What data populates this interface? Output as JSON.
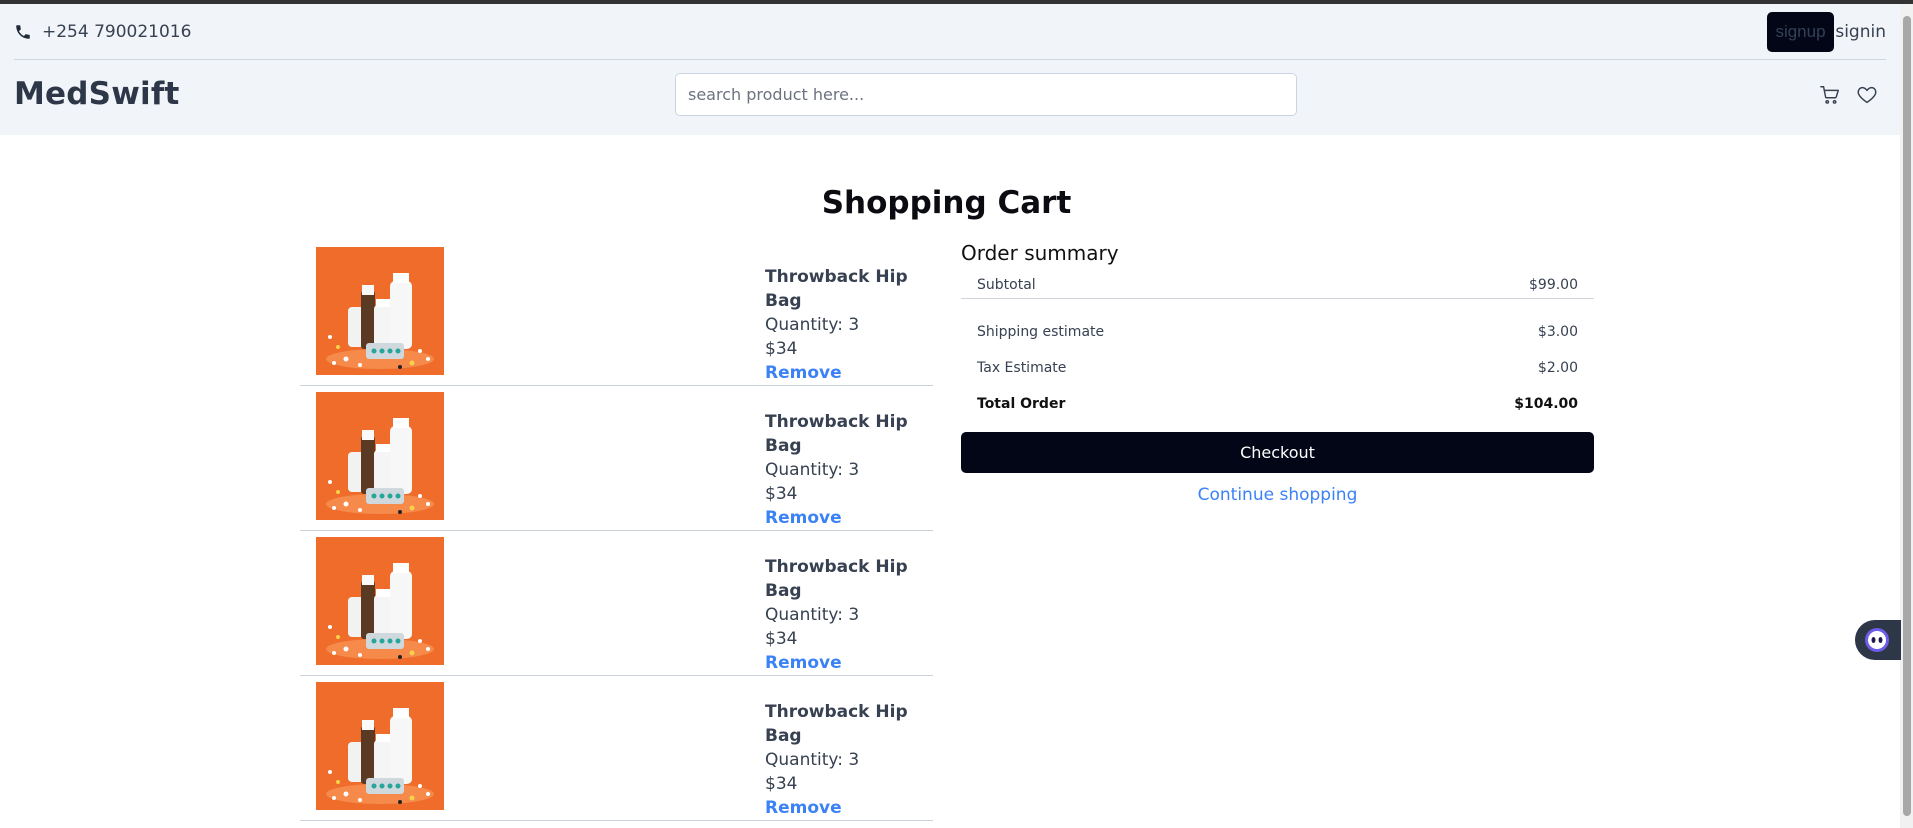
{
  "header": {
    "phone": "+254 790021016",
    "signup_label": "signup",
    "signin_label": "signin",
    "logo": "MedSwift",
    "search_placeholder": "search product here..."
  },
  "cart": {
    "title": "Shopping Cart",
    "items": [
      {
        "name": "Throwback Hip Bag",
        "quantity": "Quantity: 3",
        "price": "$34",
        "remove": "Remove"
      },
      {
        "name": "Throwback Hip Bag",
        "quantity": "Quantity: 3",
        "price": "$34",
        "remove": "Remove"
      },
      {
        "name": "Throwback Hip Bag",
        "quantity": "Quantity: 3",
        "price": "$34",
        "remove": "Remove"
      },
      {
        "name": "Throwback Hip Bag",
        "quantity": "Quantity: 3",
        "price": "$34",
        "remove": "Remove"
      }
    ]
  },
  "summary": {
    "title": "Order summary",
    "subtotal_label": "Subtotal",
    "subtotal_value": "$99.00",
    "shipping_label": "Shipping estimate",
    "shipping_value": "$3.00",
    "tax_label": "Tax Estimate",
    "tax_value": "$2.00",
    "total_label": "Total Order",
    "total_value": "$104.00",
    "checkout_label": "Checkout",
    "continue_label": "Continue shopping"
  },
  "icons": {
    "phone": "phone-icon",
    "cart": "cart-icon",
    "wishlist": "heart-icon",
    "chat": "chatbot-icon"
  },
  "colors": {
    "accent": "#3b82f6",
    "primary_button": "#020617",
    "header_bg": "#f1f5f9",
    "product_bg": "#ef6c2b"
  }
}
